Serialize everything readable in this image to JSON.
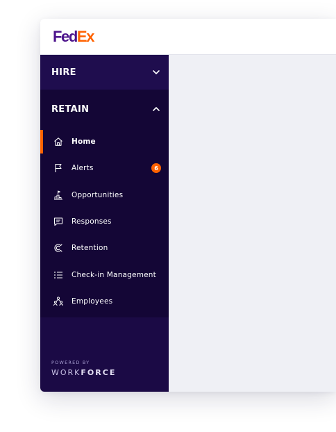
{
  "brand": {
    "logo_fed": "Fed",
    "logo_ex": "Ex"
  },
  "colors": {
    "sidebar": "#1b0a45",
    "accent": "#ff6200",
    "fedex_purple": "#4d148c",
    "main_bg": "#eff0f5"
  },
  "sidebar": {
    "sections": [
      {
        "label": "HIRE",
        "state": "collapsed",
        "icon": "chevron-down-icon"
      },
      {
        "label": "RETAIN",
        "state": "expanded",
        "icon": "chevron-up-icon"
      }
    ],
    "items": [
      {
        "label": "Home",
        "icon": "home-icon",
        "active": true
      },
      {
        "label": "Alerts",
        "icon": "flag-icon",
        "badge": "6"
      },
      {
        "label": "Opportunities",
        "icon": "opportunities-icon"
      },
      {
        "label": "Responses",
        "icon": "chat-icon"
      },
      {
        "label": "Retention",
        "icon": "magnet-icon"
      },
      {
        "label": "Check-in Management",
        "icon": "list-icon"
      },
      {
        "label": "Employees",
        "icon": "people-icon"
      }
    ],
    "footer": {
      "powered_by": "POWERED BY",
      "brand_light": "WORK",
      "brand_bold": "FORCE"
    }
  }
}
